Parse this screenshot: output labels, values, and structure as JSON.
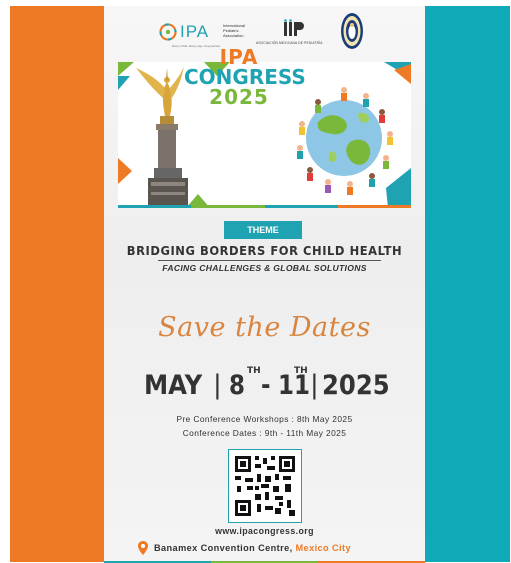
{
  "logos": {
    "ipa_name": "IPA",
    "ipa_full_name": "International Pediatric Association",
    "ipa_tagline": "Every Child. Every Age. Everywhere.",
    "amp_name": "ASOCIACIÓN MEXICANA DE PEDIATRÍA"
  },
  "hero": {
    "line1": "IPA",
    "line2": "CONGRESS",
    "line3": "2025"
  },
  "theme": {
    "badge": "THEME",
    "title": "BRIDGING BORDERS FOR CHILD HEALTH",
    "subtitle": "FACING CHALLENGES & GLOBAL SOLUTIONS"
  },
  "save_the_dates": "Save the Dates",
  "dates": {
    "month": "MAY",
    "day_start": "8",
    "suffix_start": "TH",
    "dash": "-",
    "day_end": "11",
    "suffix_end": "TH",
    "year": "2025"
  },
  "details": {
    "pre_conference": "Pre Conference Workshops : 8th May 2025",
    "conference": "Conference Dates : 9th - 11th May 2025"
  },
  "url": "www.ipacongress.org",
  "venue": {
    "place": "Banamex Convention Centre, ",
    "city": "Mexico City"
  },
  "colors": {
    "orange": "#ef7a25",
    "teal": "#10a9b8",
    "green": "#7ab83c"
  }
}
